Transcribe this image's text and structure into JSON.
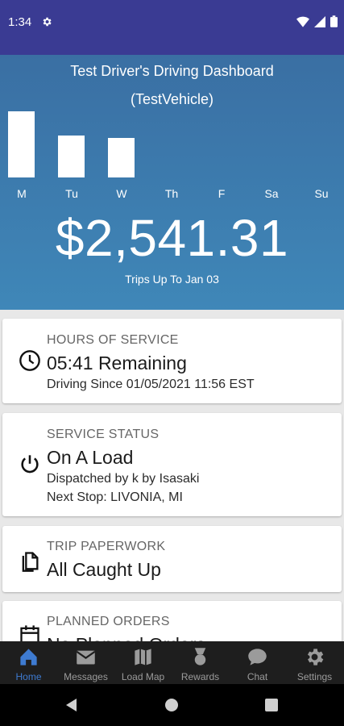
{
  "status_bar": {
    "time": "1:34"
  },
  "dashboard": {
    "title": "Test Driver's Driving Dashboard",
    "vehicle": "(TestVehicle)",
    "days": [
      "M",
      "Tu",
      "W",
      "Th",
      "F",
      "Sa",
      "Su"
    ],
    "day_bar_levels": [
      1.0,
      0.63,
      0.6,
      0,
      0,
      0,
      0
    ],
    "amount": "$2,541.31",
    "trips_caption": "Trips Up To Jan 03"
  },
  "cards": {
    "hours": {
      "label": "HOURS OF SERVICE",
      "main": "05:41 Remaining",
      "sub": "Driving Since 01/05/2021 11:56 EST"
    },
    "service": {
      "label": "SERVICE STATUS",
      "main": "On A Load",
      "sub1": "Dispatched by k by Isasaki",
      "sub2": "Next Stop: LIVONIA, MI"
    },
    "paperwork": {
      "label": "TRIP PAPERWORK",
      "main": "All Caught Up"
    },
    "planned": {
      "label": "PLANNED ORDERS",
      "main": "No Planned Orders"
    }
  },
  "bottom_nav": [
    {
      "label": "Home",
      "icon": "home-icon",
      "active": true
    },
    {
      "label": "Messages",
      "icon": "mail-icon",
      "active": false
    },
    {
      "label": "Load Map",
      "icon": "map-icon",
      "active": false
    },
    {
      "label": "Rewards",
      "icon": "rewards-icon",
      "active": false
    },
    {
      "label": "Chat",
      "icon": "chat-icon",
      "active": false
    },
    {
      "label": "Settings",
      "icon": "settings-icon",
      "active": false
    }
  ],
  "colors": {
    "status_bar": "#3a3b93",
    "hero_top": "#3a6fa3",
    "hero_bottom": "#3f87b8",
    "nav_active": "#3e7bd1",
    "nav_inactive": "#9b9b9b"
  }
}
